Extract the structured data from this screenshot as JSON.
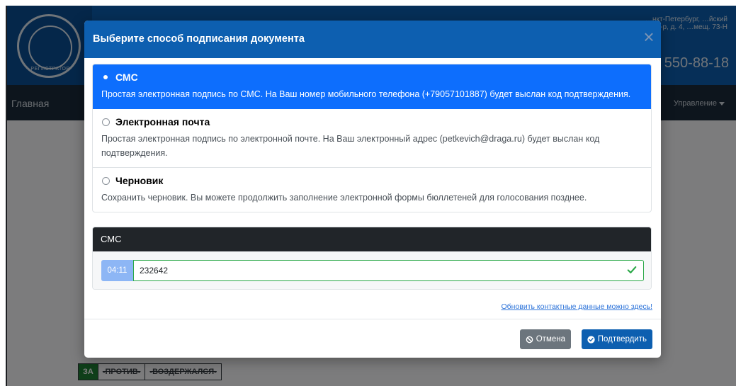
{
  "background": {
    "logo_text": "РЕГИСТРАТОР",
    "address": "…нкт-Петербург, …йский 6-р, д. 4, …мещ. 73-Н",
    "phone": ") 550-88-18",
    "nav_home": "Главная",
    "nav_manage": "Управление",
    "vote_for": "ЗА",
    "vote_against": "-ПРОТИВ-",
    "vote_abstain": "-ВОЗДЕРЖАЛСЯ-"
  },
  "modal": {
    "title": "Выберите способ подписания документа",
    "close_glyph": "×",
    "options": [
      {
        "title": "СМС",
        "description": "Простая электронная подпись по СМС. На Ваш номер мобильного телефона (+79057101887) будет выслан код подтверждения.",
        "selected": true
      },
      {
        "title": "Электронная почта",
        "description": "Простая электронная подпись по электронной почте. На Ваш электронный адрес (petkevich@draga.ru) будет выслан код подтверждения.",
        "selected": false
      },
      {
        "title": "Черновик",
        "description": "Сохранить черновик. Вы можете продолжить заполнение электронной формы бюллетеней для голосования позднее.",
        "selected": false
      }
    ],
    "sms": {
      "header": "СМС",
      "timer": "04:11",
      "code_value": "232642"
    },
    "update_link": "Обновить контактные данные можно здесь!",
    "cancel_label": "Отмена",
    "confirm_label": "Подтвердить"
  },
  "colors": {
    "primary": "#0d6efd",
    "header_blue": "#0d5fb0",
    "success": "#28a745",
    "secondary": "#6c757d",
    "dark": "#212529"
  },
  "icons": {
    "close": "close-icon",
    "check": "check-icon",
    "cancel": "ban-icon",
    "confirm": "check-circle-icon"
  }
}
